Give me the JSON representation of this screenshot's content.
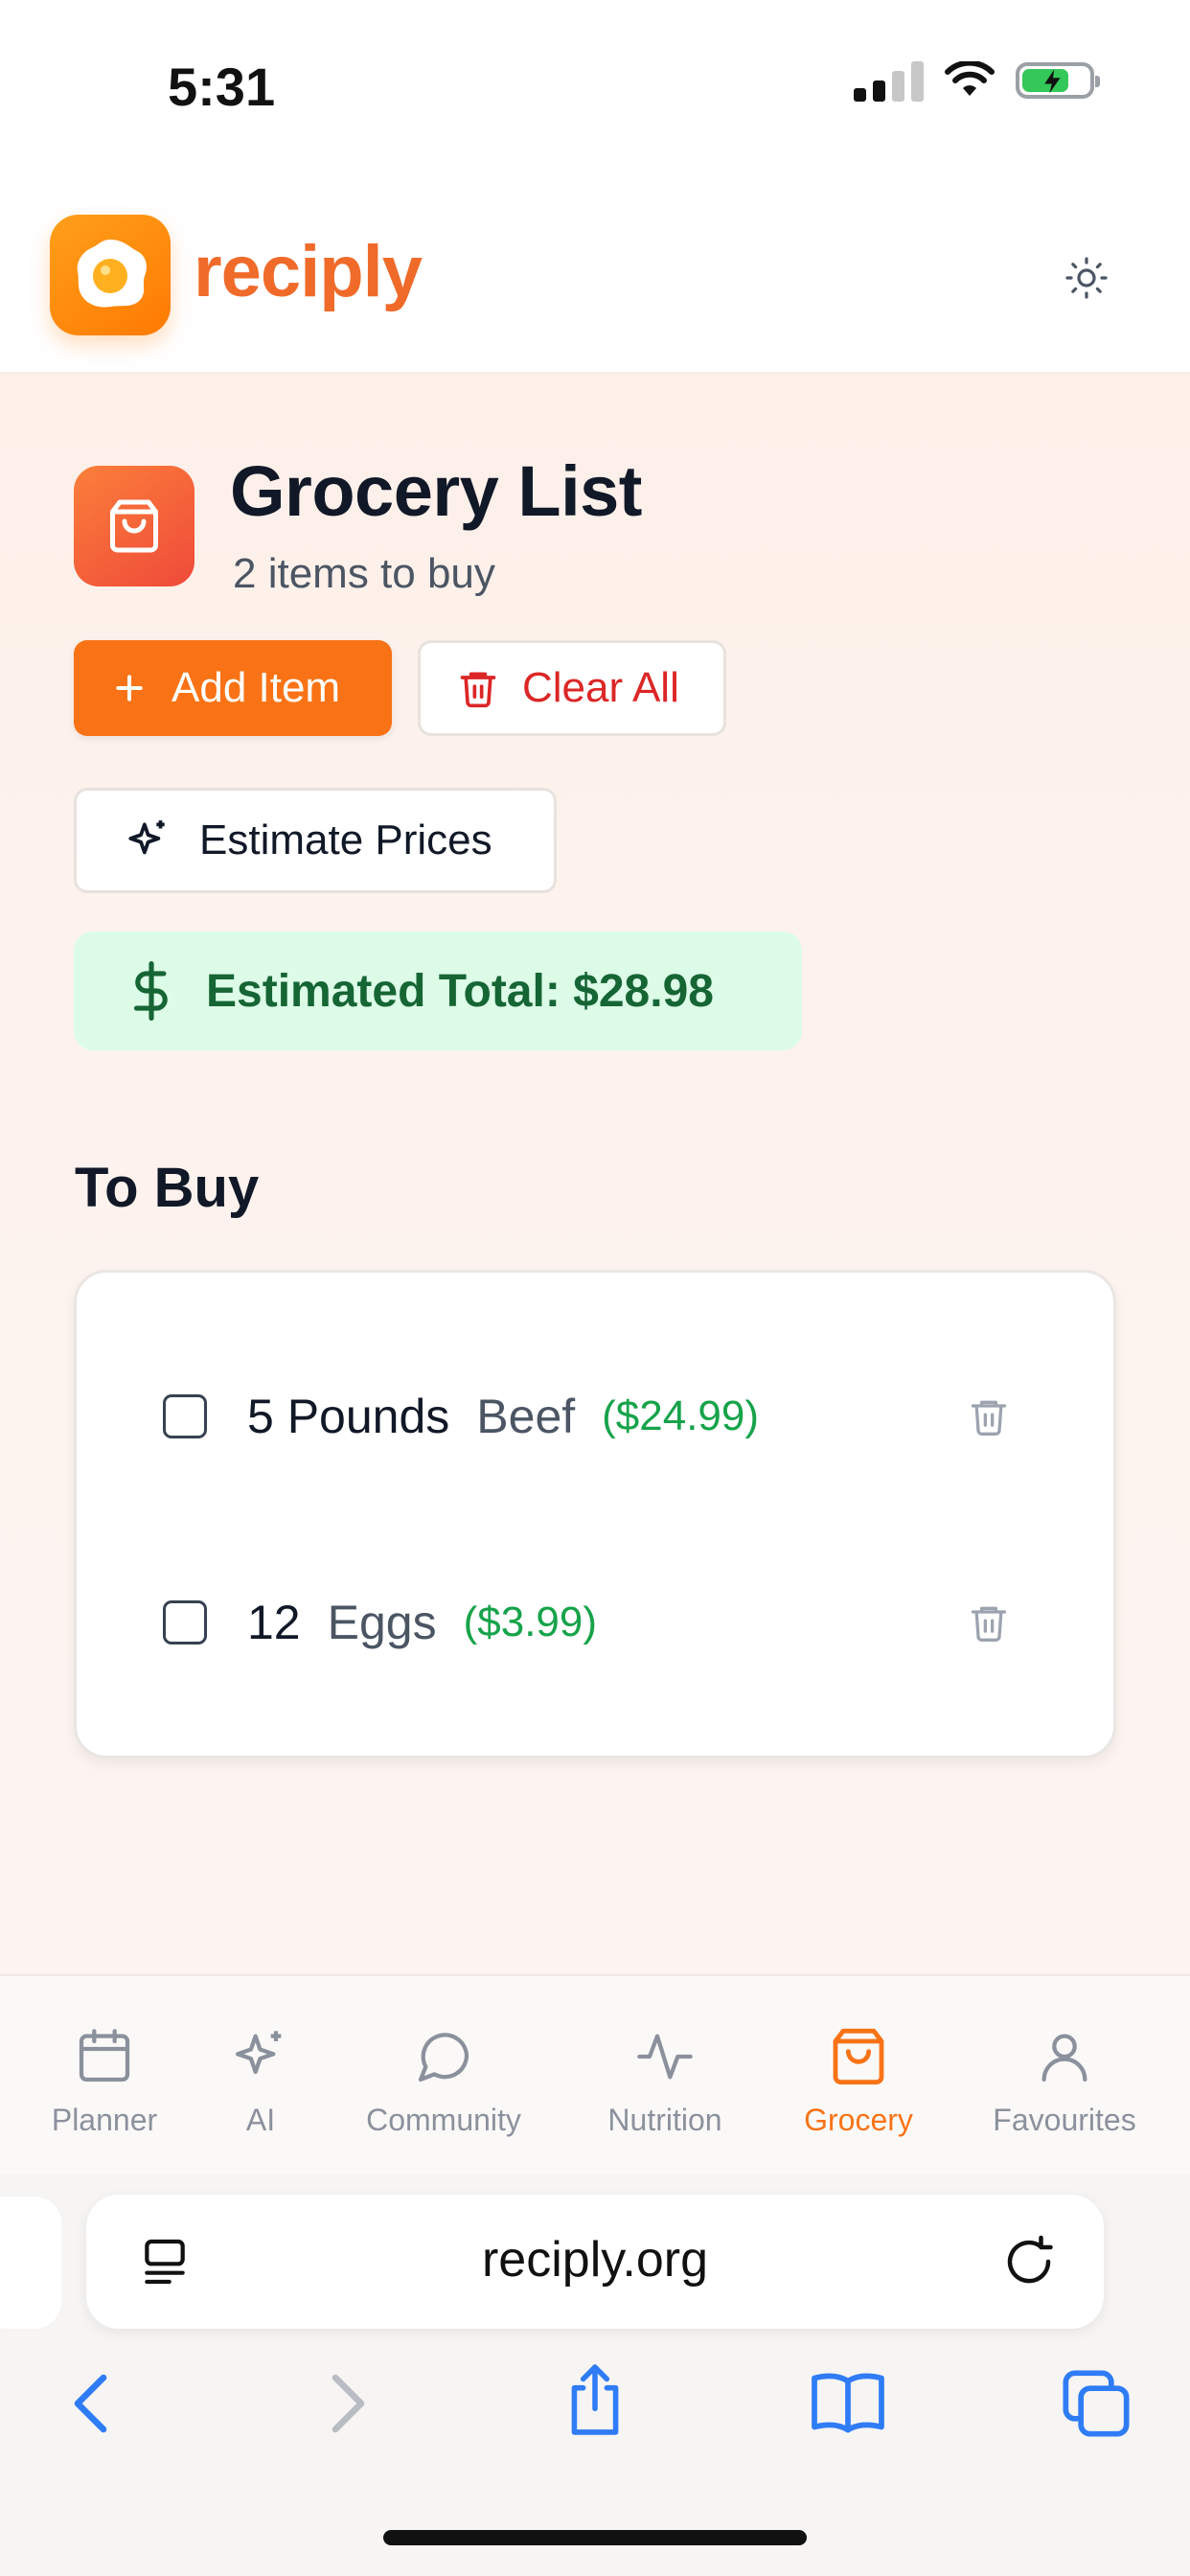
{
  "status_bar": {
    "time": "5:31"
  },
  "app": {
    "name": "reciply"
  },
  "page": {
    "title": "Grocery List",
    "subtitle": "2 items to buy",
    "buttons": {
      "add_item": "Add Item",
      "clear_all": "Clear All",
      "estimate_prices": "Estimate Prices"
    },
    "estimated_total": "Estimated Total: $28.98",
    "section_title": "To Buy",
    "items": [
      {
        "qty": "5 Pounds",
        "name": "Beef",
        "price": "($24.99)",
        "checked": false
      },
      {
        "qty": "12",
        "name": "Eggs",
        "price": "($3.99)",
        "checked": false
      }
    ]
  },
  "bottom_nav": {
    "active": "Grocery",
    "items": [
      {
        "label": "Planner",
        "icon": "calendar-icon"
      },
      {
        "label": "AI",
        "icon": "sparkles-icon"
      },
      {
        "label": "Community",
        "icon": "chat-bubble-icon"
      },
      {
        "label": "Nutrition",
        "icon": "activity-icon"
      },
      {
        "label": "Grocery",
        "icon": "shopping-bag-icon"
      },
      {
        "label": "Favourites",
        "icon": "user-icon"
      }
    ]
  },
  "browser": {
    "url": "reciply.org"
  },
  "colors": {
    "brand_orange": "#f97316",
    "danger_red": "#dc2626",
    "success_green": "#16a34a",
    "ios_blue": "#2f7cf6"
  }
}
